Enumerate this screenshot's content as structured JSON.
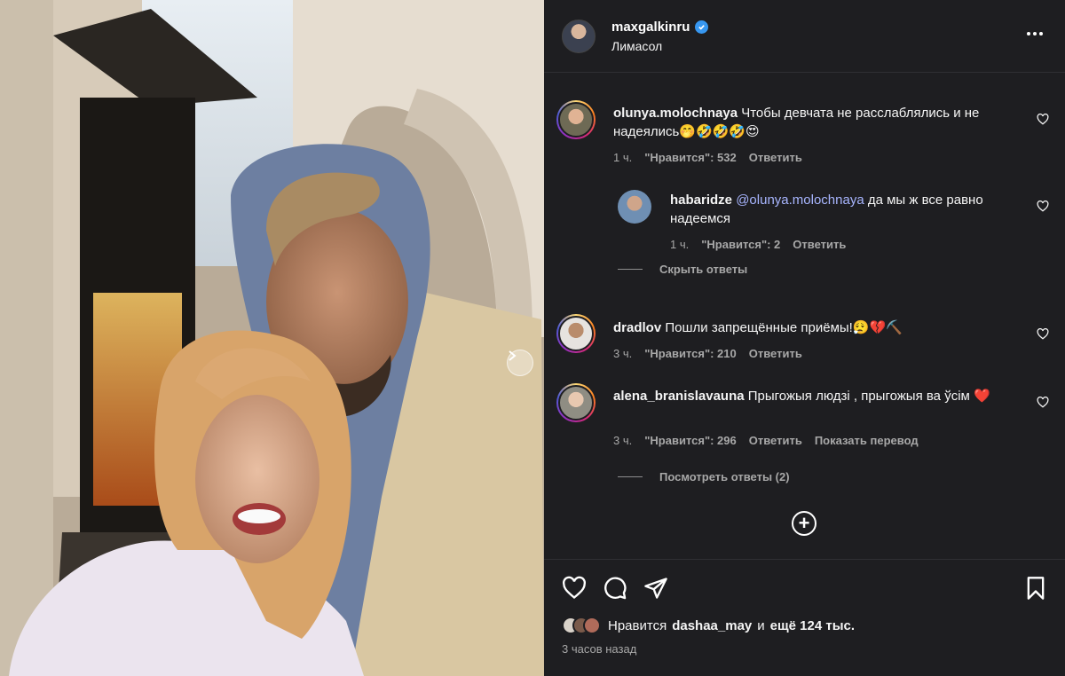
{
  "post": {
    "author": "maxgalkinru",
    "location": "Лимасол",
    "likes_prefix": "Нравится",
    "likes_user": "dashaa_may",
    "likes_and": "и",
    "likes_rest": "ещё 124 тыс.",
    "time_ago": "3 часов назад"
  },
  "comments": [
    {
      "user": "olunya.molochnaya",
      "text": "Чтобы девчата не расслаблялись и не надеялись🤭🤣🤣🤣😍",
      "time": "1 ч.",
      "likes": "\"Нравится\": 532",
      "reply": "Ответить"
    },
    {
      "user": "habaridze",
      "mention": "@olunya.molochnaya",
      "text": "да мы ж все равно надеемся",
      "time": "1 ч.",
      "likes": "\"Нравится\": 2",
      "reply": "Ответить"
    },
    {
      "user": "dradlov",
      "text": "Пошли запрещённые приёмы!😮‍💨💔⛏️",
      "time": "3 ч.",
      "likes": "\"Нравится\": 210",
      "reply": "Ответить"
    },
    {
      "user": "alena_branislavauna",
      "text": "Прыгожыя людзі , прыгожыя ва ўсім ❤️",
      "time": "3 ч.",
      "likes": "\"Нравится\": 296",
      "reply": "Ответить",
      "translate": "Показать перевод"
    }
  ],
  "threads": {
    "hide_replies": "Скрыть ответы",
    "view_replies": "Посмотреть ответы (2)"
  },
  "colors": {
    "panel_bg": "#1e1e21",
    "verified": "#3797f0",
    "mention": "#a8b6ff",
    "muted": "#a8a8a8"
  }
}
